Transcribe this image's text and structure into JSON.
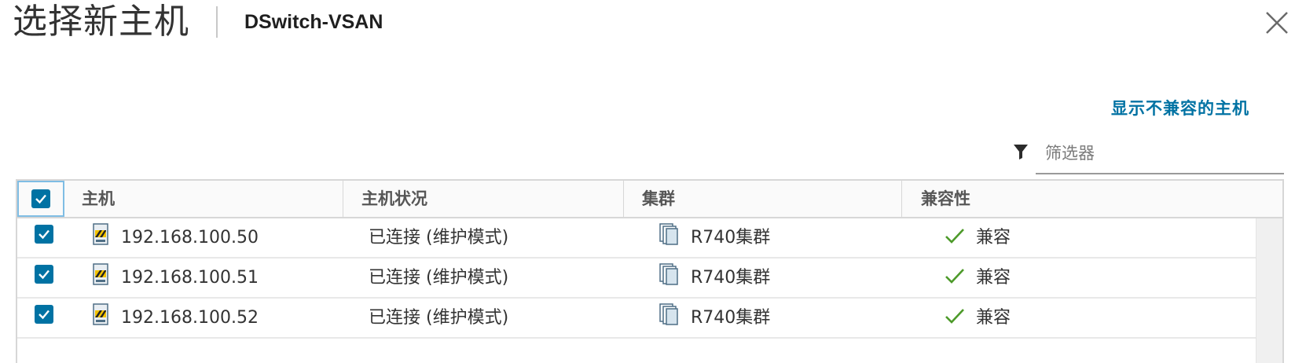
{
  "dialog": {
    "title": "选择新主机",
    "subtitle": "DSwitch-VSAN",
    "show_incompatible_link": "显示不兼容的主机"
  },
  "filter": {
    "placeholder": "筛选器",
    "value": ""
  },
  "icons": {
    "close": "close-icon",
    "filter": "filter-icon",
    "host": "host-maintenance-icon",
    "cluster": "cluster-icon",
    "compatible": "checkmark-icon"
  },
  "colors": {
    "accent": "#0072a3",
    "compatible_green": "#4d9a2a",
    "header_bg": "#fafafa",
    "border": "#d7d7d7"
  },
  "grid": {
    "select_all_checked": true,
    "columns": [
      "主机",
      "主机状况",
      "集群",
      "兼容性"
    ],
    "rows": [
      {
        "checked": true,
        "host": "192.168.100.50",
        "status": "已连接 (维护模式)",
        "cluster": "R740集群",
        "compatibility": "兼容"
      },
      {
        "checked": true,
        "host": "192.168.100.51",
        "status": "已连接 (维护模式)",
        "cluster": "R740集群",
        "compatibility": "兼容"
      },
      {
        "checked": true,
        "host": "192.168.100.52",
        "status": "已连接 (维护模式)",
        "cluster": "R740集群",
        "compatibility": "兼容"
      }
    ]
  }
}
